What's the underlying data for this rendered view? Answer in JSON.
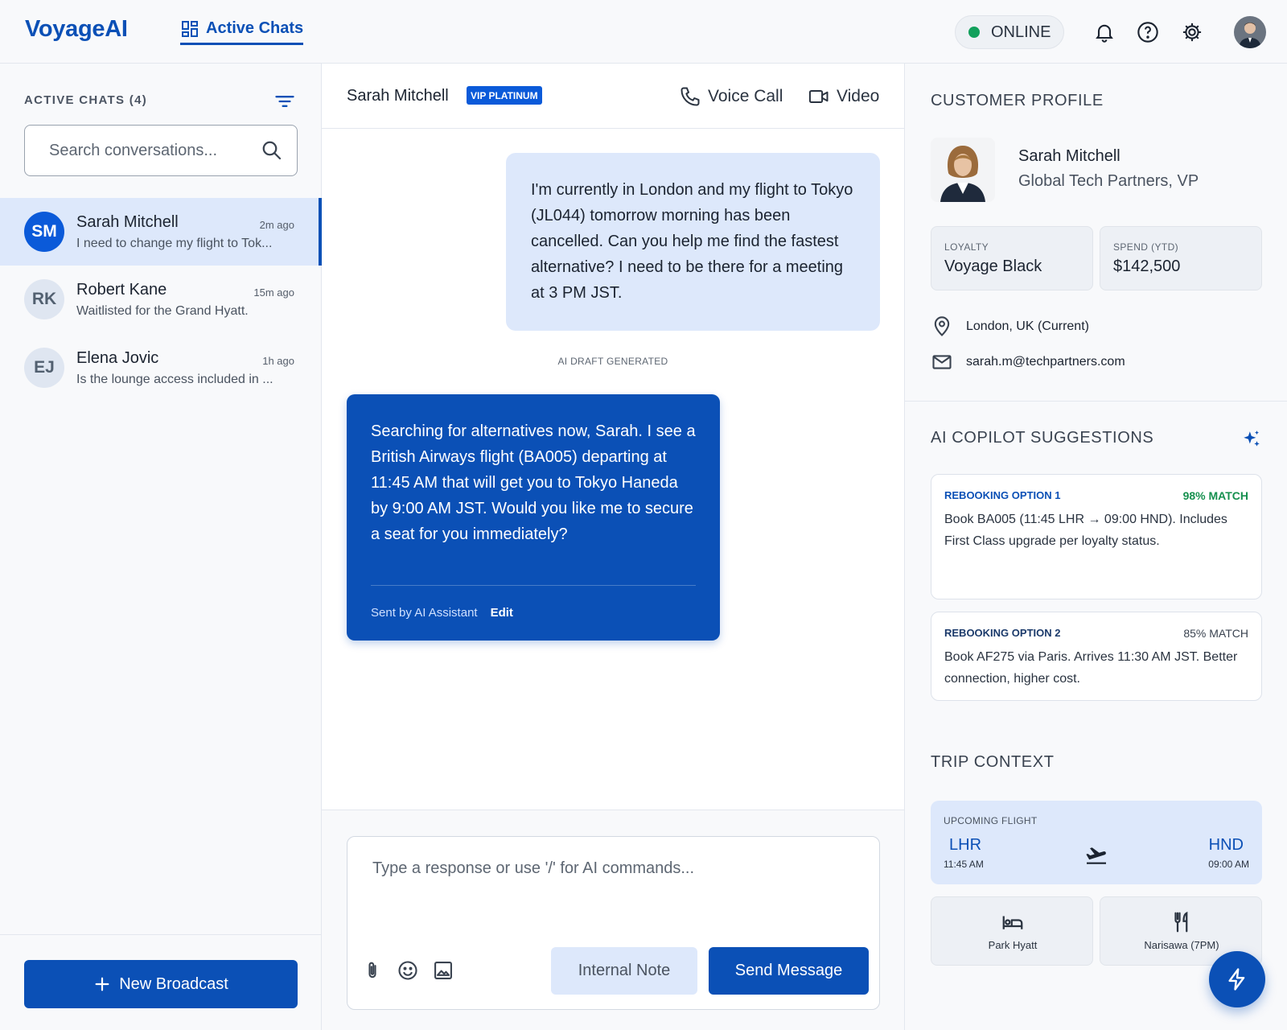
{
  "header": {
    "logo": "VoyageAI",
    "nav_active": "Active Chats",
    "status": "ONLINE",
    "icons": [
      "bell-icon",
      "help-icon",
      "gear-icon"
    ]
  },
  "sidebar": {
    "title": "ACTIVE CHATS (4)",
    "search_placeholder": "Search conversations...",
    "chats": [
      {
        "initials": "SM",
        "name": "Sarah Mitchell",
        "time": "2m ago",
        "preview": "I need to change my flight to Tok...",
        "active": true
      },
      {
        "initials": "RK",
        "name": "Robert Kane",
        "time": "15m ago",
        "preview": "Waitlisted for the Grand Hyatt.",
        "active": false
      },
      {
        "initials": "EJ",
        "name": "Elena Jovic",
        "time": "1h ago",
        "preview": "Is the lounge access included in ...",
        "active": false
      }
    ],
    "broadcast_label": "New Broadcast"
  },
  "chat": {
    "customer_name": "Sarah Mitchell",
    "badge": "VIP PLATINUM",
    "voice_call": "Voice Call",
    "video": "Video",
    "user_message": "I'm currently in London and my flight to Tokyo (JL044) tomorrow morning has been cancelled. Can you help me find the fastest alternative? I need to be there for a meeting at 3 PM JST.",
    "ai_draft_label": "AI DRAFT GENERATED",
    "ai_message": "Searching for alternatives now, Sarah. I see a British Airways flight (BA005) departing at 11:45 AM that will get you to Tokyo Haneda by 9:00 AM JST. Would you like me to secure a seat for you immediately?",
    "ai_sent_by": "Sent by AI Assistant",
    "ai_edit": "Edit",
    "composer_placeholder": "Type a response or use '/' for AI commands...",
    "internal_note": "Internal Note",
    "send": "Send Message"
  },
  "profile": {
    "title": "CUSTOMER PROFILE",
    "name": "Sarah Mitchell",
    "role": "Global Tech Partners, VP",
    "loyalty_label": "LOYALTY",
    "loyalty_value": "Voyage Black",
    "spend_label": "SPEND (YTD)",
    "spend_value": "$142,500",
    "location": "London, UK (Current)",
    "email": "sarah.m@techpartners.com"
  },
  "copilot": {
    "title": "AI COPILOT SUGGESTIONS",
    "suggestions": [
      {
        "title": "REBOOKING OPTION 1",
        "match": "98% MATCH",
        "text": "Book BA005 (11:45 LHR → 09:00 HND). Includes First Class upgrade per loyalty status."
      },
      {
        "title": "REBOOKING OPTION 2",
        "match": "85% MATCH",
        "text": "Book AF275 via Paris. Arrives 11:30 AM JST. Better connection, higher cost."
      }
    ]
  },
  "trip": {
    "title": "TRIP CONTEXT",
    "flight_label": "UPCOMING FLIGHT",
    "from_code": "LHR",
    "from_time": "11:45 AM",
    "to_code": "HND",
    "to_time": "09:00 AM",
    "hotel": "Park Hyatt",
    "dinner": "Narisawa (7PM)"
  },
  "colors": {
    "primary": "#0b50b6",
    "accent_light": "#dde8fb",
    "online": "#12a05c",
    "match_high": "#16904f"
  }
}
